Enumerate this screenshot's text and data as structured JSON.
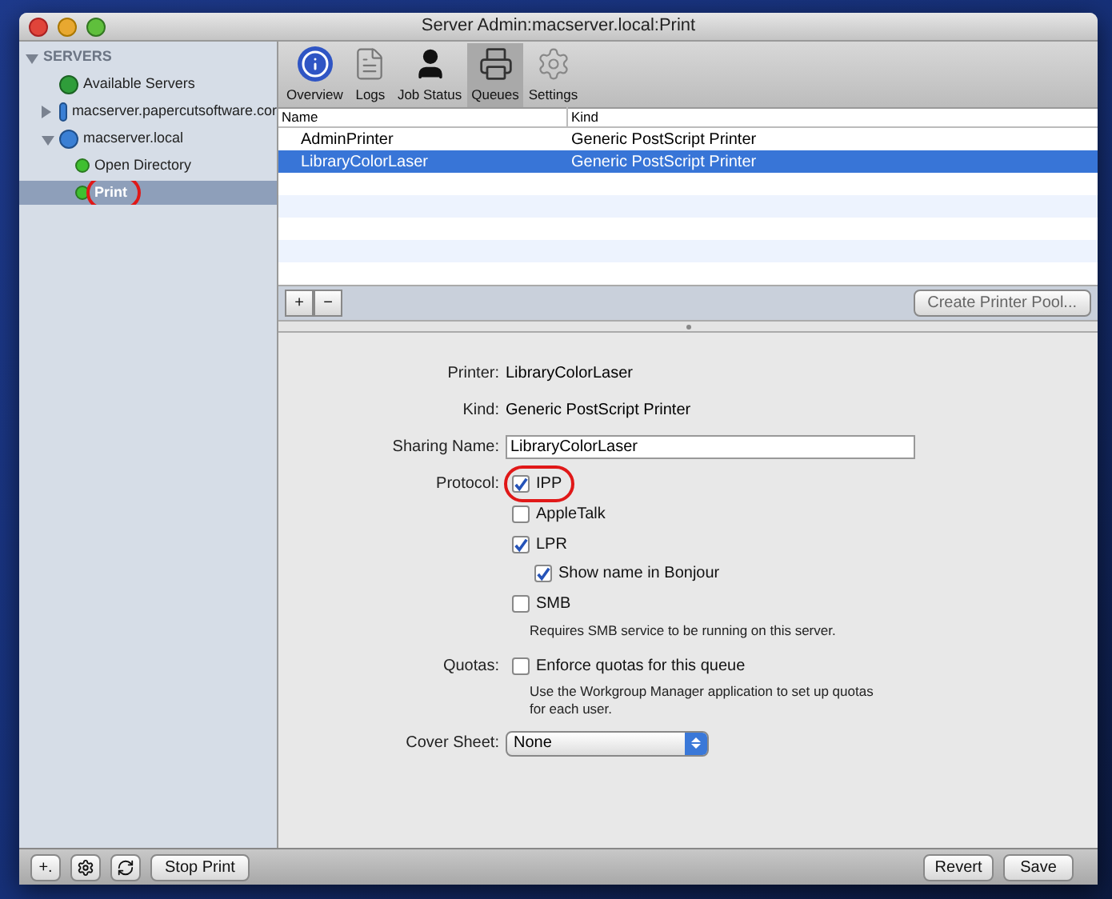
{
  "window": {
    "title": "Server Admin:macserver.local:Print"
  },
  "sidebar": {
    "items": [
      {
        "label": "SERVERS",
        "kind": "header",
        "expanded": true,
        "children": [
          {
            "label": "Available Servers",
            "kind": "globe-group",
            "selected": false,
            "circled": false
          },
          {
            "label": "macserver.papercutsoftware.cor",
            "kind": "server",
            "expanded": false,
            "selected": false,
            "circled": false
          },
          {
            "label": "macserver.local",
            "kind": "server",
            "expanded": true,
            "selected": false,
            "circled": false,
            "children": [
              {
                "label": "Open Directory",
                "kind": "service",
                "selected": false,
                "circled": false
              },
              {
                "label": "Print",
                "kind": "service",
                "selected": true,
                "circled": true
              }
            ]
          }
        ]
      }
    ]
  },
  "toolbar": [
    {
      "label": "Overview",
      "kind": "info",
      "selected": false
    },
    {
      "label": "Logs",
      "kind": "doc",
      "selected": false
    },
    {
      "label": "Job Status",
      "kind": "person",
      "selected": false
    },
    {
      "label": "Queues",
      "kind": "printer",
      "selected": true
    },
    {
      "label": "Settings",
      "kind": "gear",
      "selected": false
    }
  ],
  "table": {
    "columns": [
      "Name",
      "Kind"
    ],
    "rows": [
      {
        "cells": [
          "AdminPrinter",
          "Generic PostScript Printer"
        ],
        "selected": false
      },
      {
        "cells": [
          "LibraryColorLaser",
          "Generic PostScript Printer"
        ],
        "selected": true
      }
    ]
  },
  "table_buttons": [
    "+",
    "−"
  ],
  "create_pool_button": "Create Printer Pool...",
  "details": {
    "printer_label": "Printer:",
    "printer": "LibraryColorLaser",
    "kind_label": "Kind:",
    "kind": "Generic PostScript Printer",
    "sharing_label": "Sharing Name:",
    "sharing_name": "LibraryColorLaser",
    "protocol_label": "Protocol:",
    "protocols": [
      {
        "label": "IPP",
        "checked": true,
        "circled": true
      },
      {
        "label": "AppleTalk",
        "checked": false,
        "circled": false
      },
      {
        "label": "LPR",
        "checked": true,
        "circled": false,
        "children": [
          {
            "label": "Show name in Bonjour",
            "checked": true,
            "circled": false
          }
        ]
      },
      {
        "label": "SMB",
        "checked": false,
        "circled": false,
        "note": "Requires SMB service to be running on this server."
      }
    ],
    "quotas_label": "Quotas:",
    "quotas": {
      "label": "Enforce quotas for this queue",
      "checked": false,
      "note": "Use the Workgroup Manager application to set up quotas for each user."
    },
    "cover_label": "Cover Sheet:",
    "cover_sheet": "None"
  },
  "bottom_bar": {
    "left_buttons": [
      {
        "label": "+.",
        "kind": "text"
      },
      {
        "kind": "gear"
      },
      {
        "kind": "refresh"
      }
    ],
    "stop_button": "Stop Print",
    "revert_button": "Revert",
    "save_button": "Save"
  }
}
